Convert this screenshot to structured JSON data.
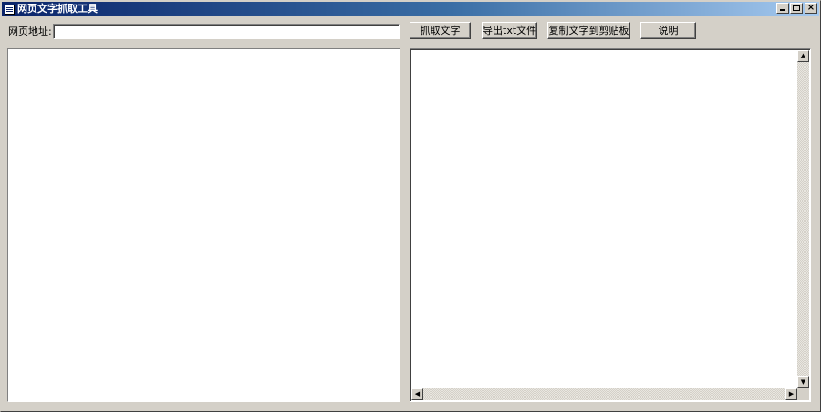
{
  "window": {
    "title": "网页文字抓取工具",
    "controls": {
      "minimize": "_",
      "maximize": "□",
      "close": "×"
    }
  },
  "form": {
    "url_label": "网页地址:",
    "url_value": "",
    "url_placeholder": ""
  },
  "toolbar": {
    "grab_label": "抓取文字",
    "export_label": "导出txt文件",
    "copy_label": "复制文字到剪贴板",
    "help_label": "说明"
  },
  "scrollbar": {
    "up": "▲",
    "down": "▼",
    "left": "◀",
    "right": "▶"
  },
  "icons": {
    "app": "app-window-icon",
    "minimize": "minimize-icon",
    "maximize": "maximize-icon",
    "close": "close-icon"
  }
}
